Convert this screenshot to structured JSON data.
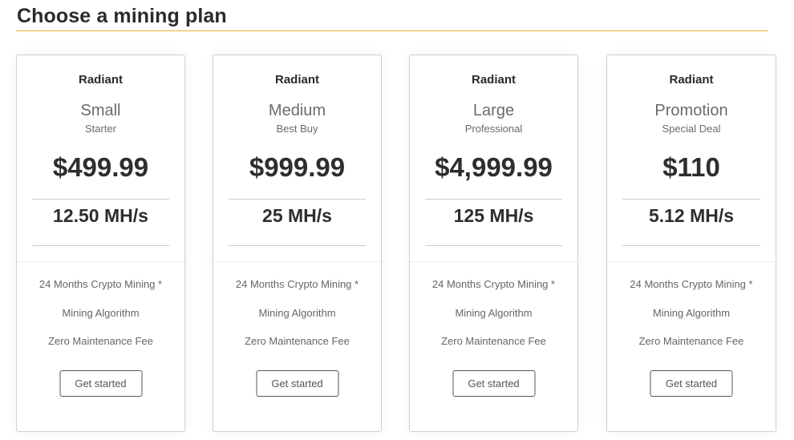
{
  "header": {
    "title": "Choose a mining plan",
    "accent_color": "#e9b32a"
  },
  "plans": [
    {
      "brand": "Radiant",
      "name": "Small",
      "tagline": "Starter",
      "price": "$499.99",
      "hashrate": "12.50 MH/s",
      "features": [
        "24 Months Crypto Mining *",
        "Mining Algorithm",
        "Zero Maintenance Fee"
      ],
      "cta": "Get started"
    },
    {
      "brand": "Radiant",
      "name": "Medium",
      "tagline": "Best Buy",
      "price": "$999.99",
      "hashrate": "25 MH/s",
      "features": [
        "24 Months Crypto Mining *",
        "Mining Algorithm",
        "Zero Maintenance Fee"
      ],
      "cta": "Get started"
    },
    {
      "brand": "Radiant",
      "name": "Large",
      "tagline": "Professional",
      "price": "$4,999.99",
      "hashrate": "125 MH/s",
      "features": [
        "24 Months Crypto Mining *",
        "Mining Algorithm",
        "Zero Maintenance Fee"
      ],
      "cta": "Get started"
    },
    {
      "brand": "Radiant",
      "name": "Promotion",
      "tagline": "Special Deal",
      "price": "$110",
      "hashrate": "5.12 MH/s",
      "features": [
        "24 Months Crypto Mining *",
        "Mining Algorithm",
        "Zero Maintenance Fee"
      ],
      "cta": "Get started"
    }
  ]
}
